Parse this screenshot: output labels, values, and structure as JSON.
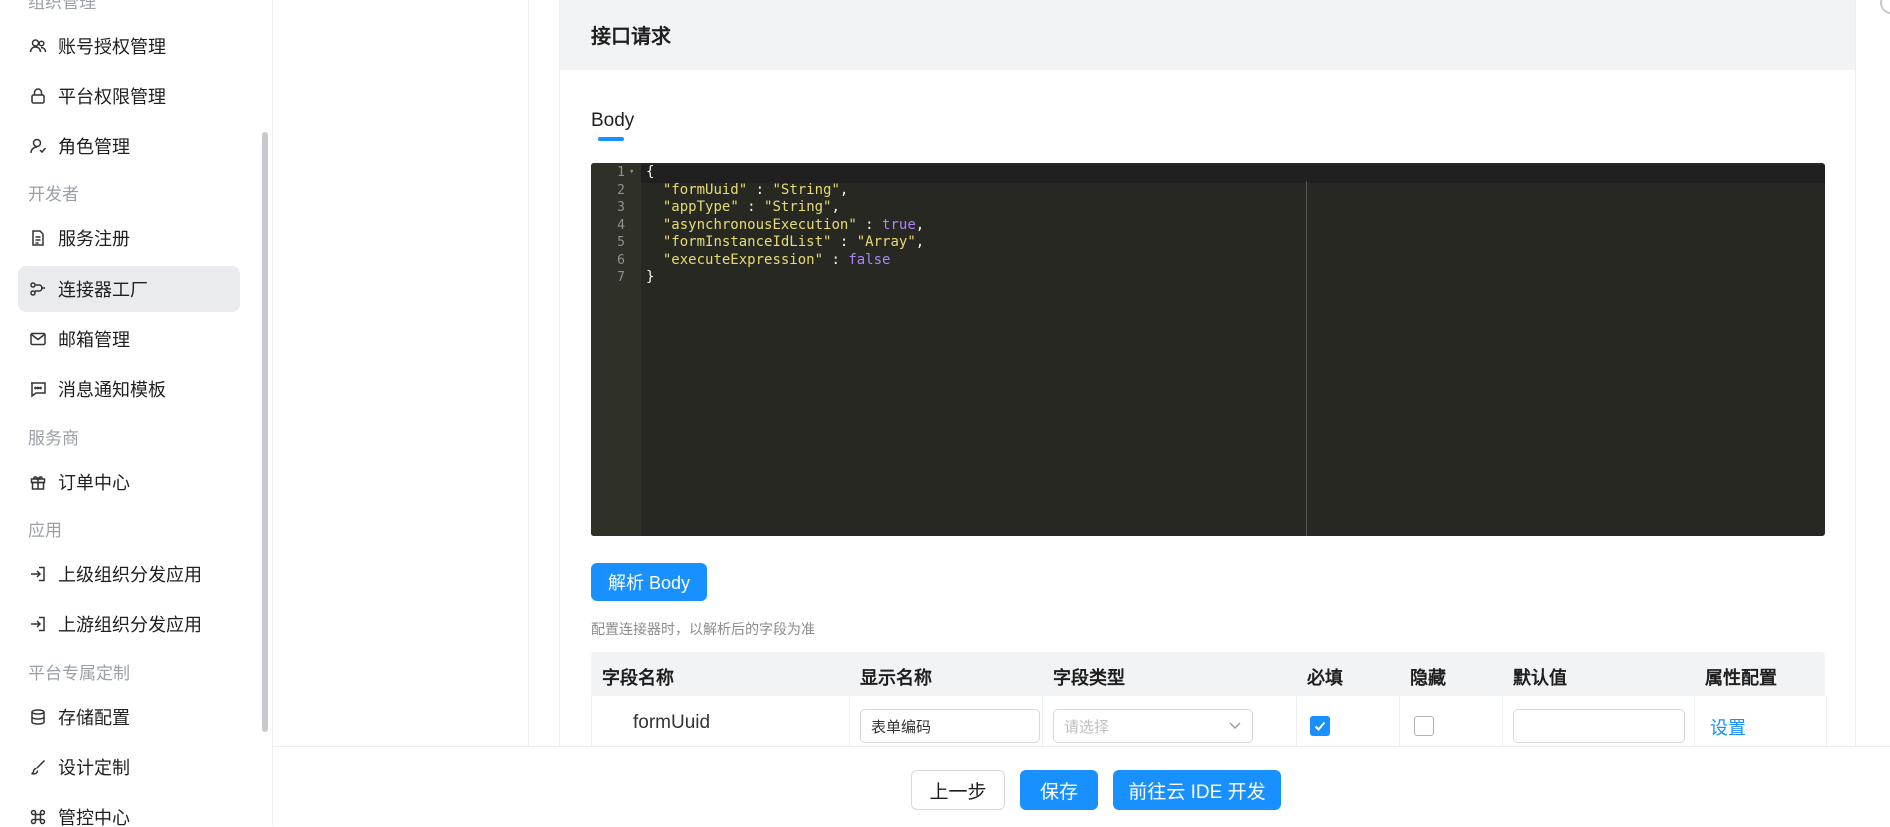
{
  "sidebar": {
    "groups": {
      "org_mgmt": "组织管理",
      "developer": "开发者",
      "provider": "服务商",
      "apps": "应用",
      "platform_custom": "平台专属定制"
    },
    "items": [
      {
        "label": "账号授权管理",
        "icon": "users-icon"
      },
      {
        "label": "平台权限管理",
        "icon": "lock-icon"
      },
      {
        "label": "角色管理",
        "icon": "user-role-icon"
      },
      {
        "label": "服务注册",
        "icon": "document-icon"
      },
      {
        "label": "连接器工厂",
        "icon": "connector-icon"
      },
      {
        "label": "邮箱管理",
        "icon": "mail-icon"
      },
      {
        "label": "消息通知模板",
        "icon": "message-icon"
      },
      {
        "label": "订单中心",
        "icon": "gift-icon"
      },
      {
        "label": "上级组织分发应用",
        "icon": "login-icon"
      },
      {
        "label": "上游组织分发应用",
        "icon": "login-icon"
      },
      {
        "label": "存储配置",
        "icon": "database-icon"
      },
      {
        "label": "设计定制",
        "icon": "brush-icon"
      },
      {
        "label": "管控中心",
        "icon": "command-icon"
      }
    ],
    "active_item": "连接器工厂"
  },
  "card": {
    "title": "接口请求",
    "tab": "Body",
    "editor": {
      "line_numbers": [
        "1",
        "2",
        "3",
        "4",
        "5",
        "6",
        "7"
      ],
      "lines": [
        {
          "key": "formUuid",
          "value": "\"String\""
        },
        {
          "key": "appType",
          "value": "\"String\""
        },
        {
          "key": "asynchronousExecution",
          "value": "true"
        },
        {
          "key": "formInstanceIdList",
          "value": "\"Array\""
        },
        {
          "key": "executeExpression",
          "value": "false"
        }
      ]
    },
    "parse_button": "解析 Body",
    "hint": "配置连接器时，以解析后的字段为准",
    "table": {
      "headers": [
        "字段名称",
        "显示名称",
        "字段类型",
        "必填",
        "隐藏",
        "默认值",
        "属性配置"
      ],
      "row": {
        "field_name": "formUuid",
        "display_name": "表单编码",
        "type_placeholder": "请选择",
        "required": true,
        "hidden": false,
        "default_value": "",
        "config_link": "设置"
      }
    }
  },
  "footer": {
    "prev": "上一步",
    "save": "保存",
    "ide": "前往云 IDE 开发"
  },
  "colors": {
    "accent": "#1890ff",
    "editor_bg": "#272822",
    "active_nav_bg": "#e9ebee"
  }
}
